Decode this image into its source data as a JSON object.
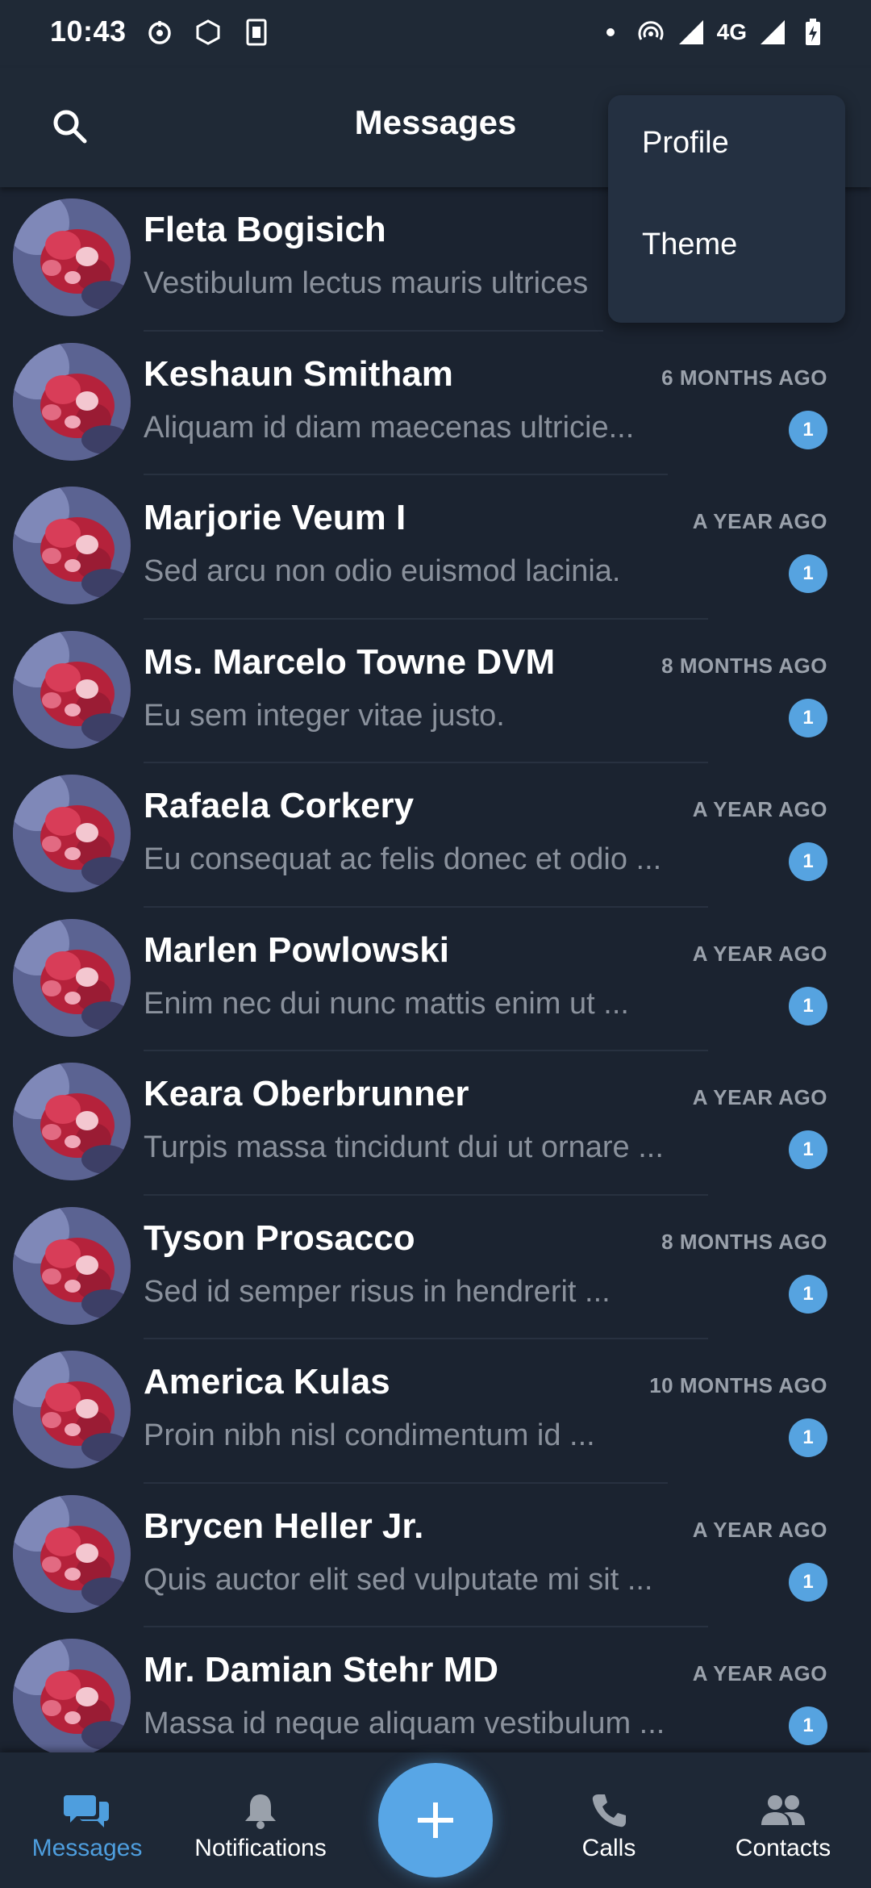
{
  "status_bar": {
    "time": "10:43",
    "network": "4G",
    "icons_left": [
      "sync-icon",
      "hexagon-icon",
      "sim-card-icon"
    ],
    "icons_right": [
      "dot-icon",
      "hotspot-icon",
      "signal-icon",
      "signal-icon",
      "battery-charging-icon"
    ]
  },
  "app_bar": {
    "title": "Messages",
    "search_icon": "search-icon"
  },
  "menu": {
    "items": [
      {
        "label": "Profile"
      },
      {
        "label": "Theme"
      }
    ]
  },
  "conversations": [
    {
      "name": "Fleta Bogisich",
      "preview": "Vestibulum lectus mauris ultrices",
      "time": "",
      "unread": ""
    },
    {
      "name": "Keshaun Smitham",
      "preview": "Aliquam id diam maecenas ultricie...",
      "time": "6 MONTHS AGO",
      "unread": "1"
    },
    {
      "name": "Marjorie Veum I",
      "preview": "Sed arcu non odio euismod lacinia.",
      "time": "A YEAR AGO",
      "unread": "1"
    },
    {
      "name": "Ms. Marcelo Towne DVM",
      "preview": "Eu sem integer vitae justo.",
      "time": "8 MONTHS AGO",
      "unread": "1"
    },
    {
      "name": "Rafaela Corkery",
      "preview": "Eu consequat ac felis donec et odio ...",
      "time": "A YEAR AGO",
      "unread": "1"
    },
    {
      "name": "Marlen Powlowski",
      "preview": "Enim nec dui nunc mattis enim ut ...",
      "time": "A YEAR AGO",
      "unread": "1"
    },
    {
      "name": "Keara Oberbrunner",
      "preview": "Turpis massa tincidunt dui ut ornare ...",
      "time": "A YEAR AGO",
      "unread": "1"
    },
    {
      "name": "Tyson Prosacco",
      "preview": "Sed id semper risus in hendrerit ...",
      "time": "8 MONTHS AGO",
      "unread": "1"
    },
    {
      "name": "America Kulas",
      "preview": "Proin nibh nisl condimentum id ...",
      "time": "10 MONTHS AGO",
      "unread": "1"
    },
    {
      "name": "Brycen Heller Jr.",
      "preview": "Quis auctor elit sed vulputate mi sit ...",
      "time": "A YEAR AGO",
      "unread": "1"
    },
    {
      "name": "Mr. Damian Stehr MD",
      "preview": "Massa id neque aliquam vestibulum ...",
      "time": "A YEAR AGO",
      "unread": "1"
    }
  ],
  "bottom_nav": {
    "items": [
      {
        "label": "Messages",
        "icon": "chat-bubbles-icon",
        "active": true
      },
      {
        "label": "Notifications",
        "icon": "bell-icon",
        "active": false
      },
      {
        "label": "Calls",
        "icon": "phone-icon",
        "active": false
      },
      {
        "label": "Contacts",
        "icon": "people-icon",
        "active": false
      }
    ],
    "fab_icon": "plus-icon"
  },
  "colors": {
    "background": "#1b2330",
    "app_bar": "#1f2936",
    "accent": "#56a3e0",
    "menu": "#243041"
  }
}
